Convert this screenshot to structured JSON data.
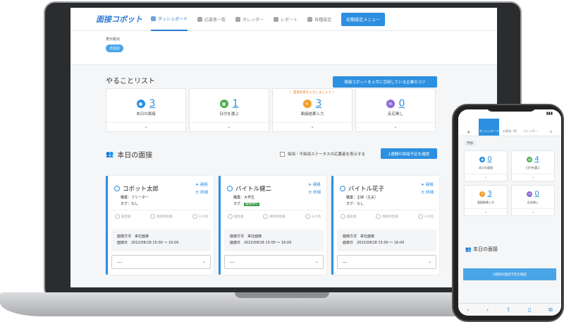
{
  "nav": {
    "logo": "面接コボット",
    "items": [
      {
        "label": "ダッシュボード",
        "icon": "dashboard-icon"
      },
      {
        "label": "応募者一覧",
        "icon": "list-icon"
      },
      {
        "label": "カレンダー",
        "icon": "calendar-icon"
      },
      {
        "label": "レポート",
        "icon": "report-icon"
      },
      {
        "label": "各種設定",
        "icon": "gear-icon"
      }
    ],
    "init_button": "初期設定メニュー"
  },
  "location": {
    "label": "表示拠点",
    "value": "渋谷店"
  },
  "todo": {
    "title": "やることリスト",
    "tips_button": "面接コボットを上手に活用している企業のコツ",
    "cards": [
      {
        "count": "3",
        "label": "本日の面接",
        "color": "#2d8fe0",
        "warn": ""
      },
      {
        "count": "1",
        "label": "日付を選ぶ",
        "color": "#4caf50",
        "warn": ""
      },
      {
        "count": "3",
        "label": "面接結果入力",
        "color": "#f0a030",
        "warn": "！ 面接結果を入力しましょう ！"
      },
      {
        "count": "0",
        "label": "反応無し",
        "color": "#8a6ad8",
        "warn": ""
      }
    ]
  },
  "today": {
    "title": "本日の面接",
    "checkbox_label": "採用・不採用ステータスの応募者を表示する",
    "week_button": "1週間の面接予定を確認"
  },
  "interviews": [
    {
      "name": "コボット太郎",
      "job": "職業：フリーター",
      "tag": "タグ：なし",
      "tag_badge": "",
      "method": "面接方法　来社面接",
      "date": "面接日　2022/08/18 15:00 ～ 16:00",
      "select": "---",
      "link1": "連絡",
      "link2": "詳細"
    },
    {
      "name": "バイトル健二",
      "job": "職業：大学生",
      "tag": "タグ：",
      "tag_badge": "面接待ち",
      "method": "面接方法　来社面接",
      "date": "面接日　2022/08/18 15:00 ～ 16:00",
      "select": "---",
      "link1": "連絡",
      "link2": "詳細"
    },
    {
      "name": "バイトル花子",
      "job": "職業：主婦（主夫）",
      "tag": "タグ：なし",
      "tag_badge": "",
      "method": "面接方法　来社面接",
      "date": "面接日　2022/08/18 15:00 ～ 16:00",
      "select": "---",
      "link1": "連絡",
      "link2": "詳細"
    }
  ],
  "steps": [
    "履歴書",
    "職務経歴書",
    "その他"
  ],
  "steps_sub": "0ファイル",
  "phone": {
    "nav": [
      "ダッシュボード",
      "応募者一覧",
      "カレンダー"
    ],
    "chip": "渋谷",
    "cards": [
      {
        "count": "0",
        "label": "本日の面接",
        "color": "#2d8fe0"
      },
      {
        "count": "4",
        "label": "日付を選ぶ",
        "color": "#4caf50"
      },
      {
        "count": "3",
        "label": "面接結果入力",
        "color": "#f0a030"
      },
      {
        "count": "0",
        "label": "反応無し",
        "color": "#8a6ad8"
      }
    ],
    "today": "本日の面接",
    "button": "1週間の面接予定を確認"
  }
}
